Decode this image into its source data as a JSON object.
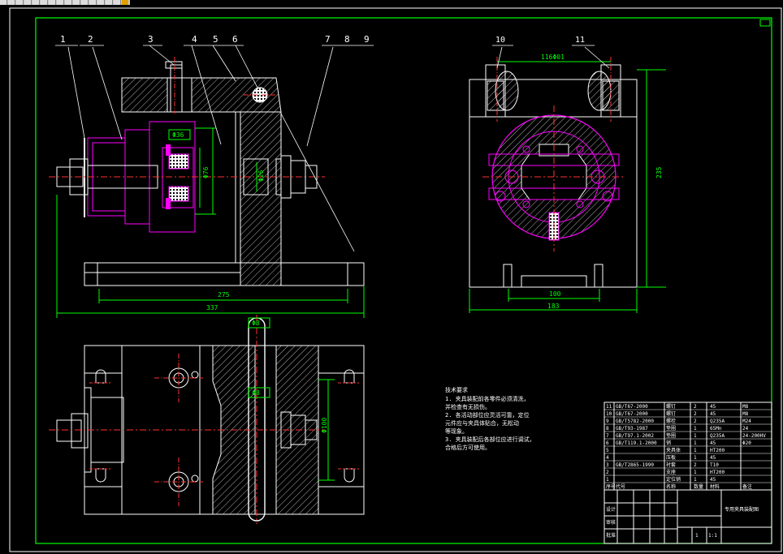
{
  "balloons_main": [
    "1",
    "2",
    "3",
    "4",
    "5",
    "6",
    "7",
    "8",
    "9"
  ],
  "balloons_side": [
    "10",
    "11"
  ],
  "dims": {
    "main_width": "275",
    "main_total": "337",
    "main_height": "Φ76",
    "fit1": "Φ36",
    "fit2": "Φ26",
    "fit3": "Φ16",
    "side_top": "116Φ01",
    "side_height": "235",
    "side_base": "100",
    "side_total": "183",
    "plan_top": "Φ8",
    "plan_mid": "Φ8",
    "plan_height": "Φ100"
  },
  "notes": {
    "title": "技术要求",
    "lines": [
      "1. 夹具装配前各零件必须清洗，",
      "   并检查有无损伤。",
      "2. 各活动部位应灵活可靠，定位",
      "   元件应与夹具体贴合，无松动",
      "   等现象。",
      "3. 夹具装配后各部位应进行调试，",
      "   合格后方可使用。"
    ]
  },
  "bom": [
    {
      "no": "11",
      "code": "GB/T67-2000",
      "name": "螺钉",
      "qty": "2",
      "mat": "45",
      "note": "M8"
    },
    {
      "no": "10",
      "code": "GB/T67-2000",
      "name": "螺钉",
      "qty": "2",
      "mat": "45",
      "note": "M8"
    },
    {
      "no": "9",
      "code": "GB/T5782-2000",
      "name": "螺栓",
      "qty": "2",
      "mat": "Q235A",
      "note": "M24"
    },
    {
      "no": "8",
      "code": "GB/T93-1987",
      "name": "垫圈",
      "qty": "1",
      "mat": "65Mn",
      "note": "24"
    },
    {
      "no": "7",
      "code": "GB/T97.1-2002",
      "name": "垫圈",
      "qty": "1",
      "mat": "Q235A",
      "note": "24-200HV"
    },
    {
      "no": "6",
      "code": "GB/T119.1-2000",
      "name": "销",
      "qty": "1",
      "mat": "45",
      "note": "Φ20"
    },
    {
      "no": "5",
      "code": "",
      "name": "夹具体",
      "qty": "1",
      "mat": "HT200",
      "note": ""
    },
    {
      "no": "4",
      "code": "",
      "name": "压板",
      "qty": "1",
      "mat": "45",
      "note": ""
    },
    {
      "no": "3",
      "code": "GB/T2865-1990",
      "name": "衬套",
      "qty": "2",
      "mat": "T10",
      "note": ""
    },
    {
      "no": "2",
      "code": "",
      "name": "支座",
      "qty": "1",
      "mat": "HT200",
      "note": ""
    },
    {
      "no": "1",
      "code": "",
      "name": "定位销",
      "qty": "1",
      "mat": "45",
      "note": ""
    }
  ],
  "bom_header": {
    "no": "序号",
    "code": "代号",
    "name": "名称",
    "qty": "数量",
    "mat": "材料",
    "note": "备注"
  },
  "title_block": {
    "title": "专用夹具装配图",
    "scale": "1:1",
    "sheet": "1",
    "designer": "设计",
    "checker": "审核",
    "approver": "批准"
  },
  "colors": {
    "frame": "#00ff00",
    "outline": "#ffffff",
    "part": "#ff00ff",
    "center": "#ff3030",
    "dim": "#00ff00",
    "text": "#ffffff"
  }
}
